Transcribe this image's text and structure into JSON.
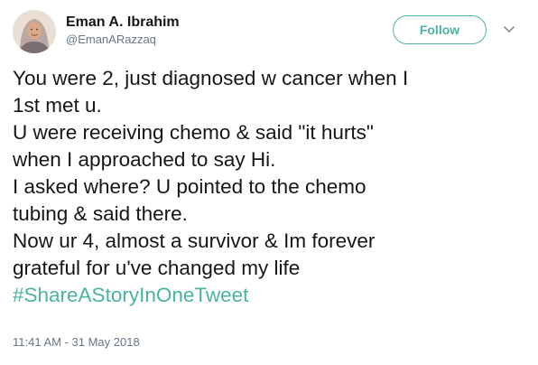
{
  "author": {
    "name": "Eman A. Ibrahim",
    "handle": "@EmanARazzaq"
  },
  "follow_button": {
    "label": "Follow"
  },
  "tweet": {
    "lines": [
      "You were 2, just diagnosed w cancer when I",
      "1st met u.",
      "U were receiving chemo & said \"it hurts\"",
      "when I approached to say Hi.",
      "I asked where? U pointed to the chemo",
      "tubing & said there.",
      "Now ur 4, almost a survivor & Im forever",
      "grateful for u've changed my life"
    ],
    "hashtag": "#ShareAStoryInOneTweet",
    "timestamp": "11:41 AM - 31 May 2018"
  },
  "icons": {
    "avatar": "profile-photo",
    "menu": "chevron-down-icon"
  },
  "colors": {
    "accent": "#4ab3a4",
    "text": "#14171a",
    "secondary_text": "#657786"
  }
}
